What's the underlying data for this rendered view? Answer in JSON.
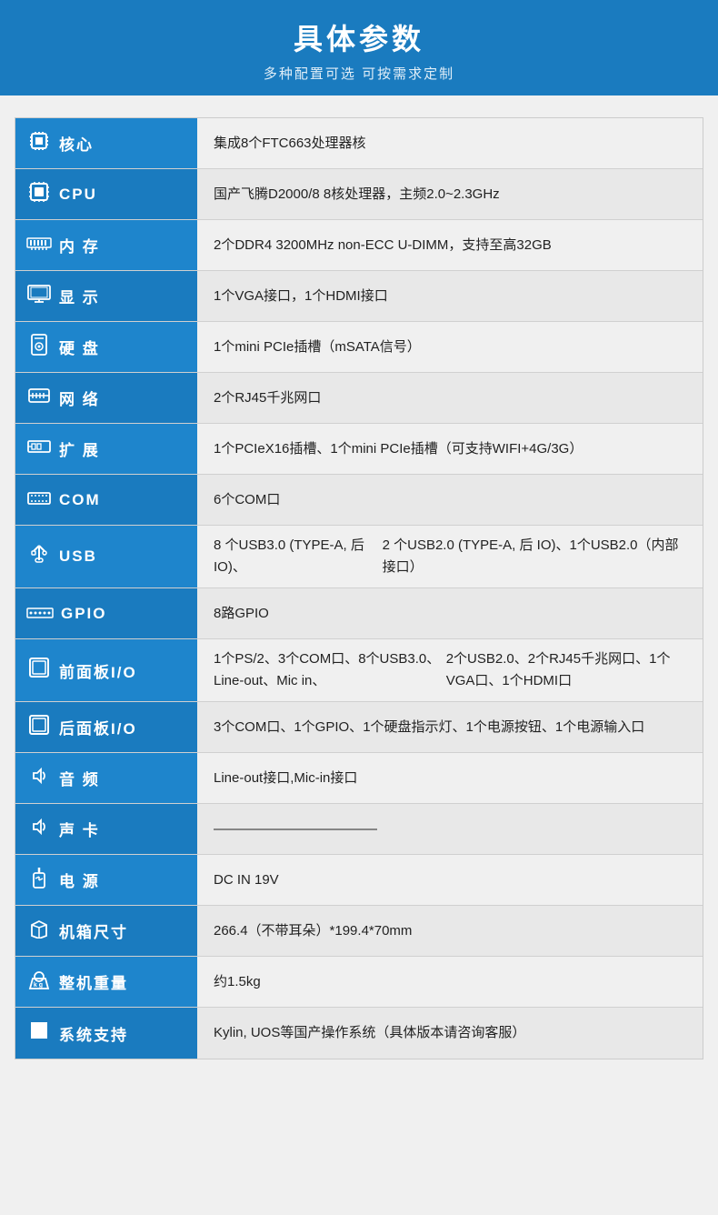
{
  "header": {
    "title": "具体参数",
    "subtitle": "多种配置可选 可按需求定制"
  },
  "rows": [
    {
      "icon": "🔲",
      "label": "核心",
      "value": "集成8个FTC663处理器核",
      "multiline": false
    },
    {
      "icon": "🖥",
      "label": "CPU",
      "value": "国产飞腾D2000/8  8核处理器，主频2.0~2.3GHz",
      "multiline": false
    },
    {
      "icon": "🔳",
      "label": "内  存",
      "value": "2个DDR4 3200MHz non-ECC U-DIMM，\n支持至高32GB",
      "multiline": true
    },
    {
      "icon": "🖵",
      "label": "显  示",
      "value": "1个VGA接口，1个HDMI接口",
      "multiline": false
    },
    {
      "icon": "💾",
      "label": "硬  盘",
      "value": "1个mini PCIe插槽（mSATA信号）",
      "multiline": false
    },
    {
      "icon": "🌐",
      "label": "网  络",
      "value": "2个RJ45千兆网口",
      "multiline": false
    },
    {
      "icon": "📦",
      "label": "扩  展",
      "value": "1个PCIeX16插槽、1个mini PCIe插槽（可支持WIFI+4G/3G）",
      "multiline": false
    },
    {
      "icon": "🔌",
      "label": "COM",
      "value": "6个COM口",
      "multiline": false
    },
    {
      "icon": "⇌",
      "label": "USB",
      "value": "8 个USB3.0 (TYPE-A, 后 IO)、\n2 个USB2.0 (TYPE-A, 后 IO)、1个USB2.0（内部接口）",
      "multiline": true
    },
    {
      "icon": "⣿",
      "label": "GPIO",
      "value": "8路GPIO",
      "multiline": false
    },
    {
      "icon": "🖼",
      "label": "前面板I/O",
      "value": "1个PS/2、3个COM口、8个USB3.0、Line-out、Mic in、\n2个USB2.0、2个RJ45千兆网口、1个VGA口、1个HDMI口",
      "multiline": true
    },
    {
      "icon": "🖼",
      "label": "后面板I/O",
      "value": "3个COM口、1个GPIO、1个硬盘指示灯、1个电源按钮、\n1个电源输入口",
      "multiline": true
    },
    {
      "icon": "🔊",
      "label": "音  频",
      "value": "Line-out接口,Mic-in接口",
      "multiline": false
    },
    {
      "icon": "🔊",
      "label": "声  卡",
      "value": "————————————",
      "multiline": false
    },
    {
      "icon": "⚡",
      "label": "电  源",
      "value": "DC IN 19V",
      "multiline": false
    },
    {
      "icon": "⚙",
      "label": "机箱尺寸",
      "value": "266.4（不带耳朵）*199.4*70mm",
      "multiline": false
    },
    {
      "icon": "⚖",
      "label": "整机重量",
      "value": "约1.5kg",
      "multiline": false
    },
    {
      "icon": "🪟",
      "label": "系统支持",
      "value": "Kylin, UOS等国产操作系统（具体版本请咨询客服）",
      "multiline": false
    }
  ]
}
